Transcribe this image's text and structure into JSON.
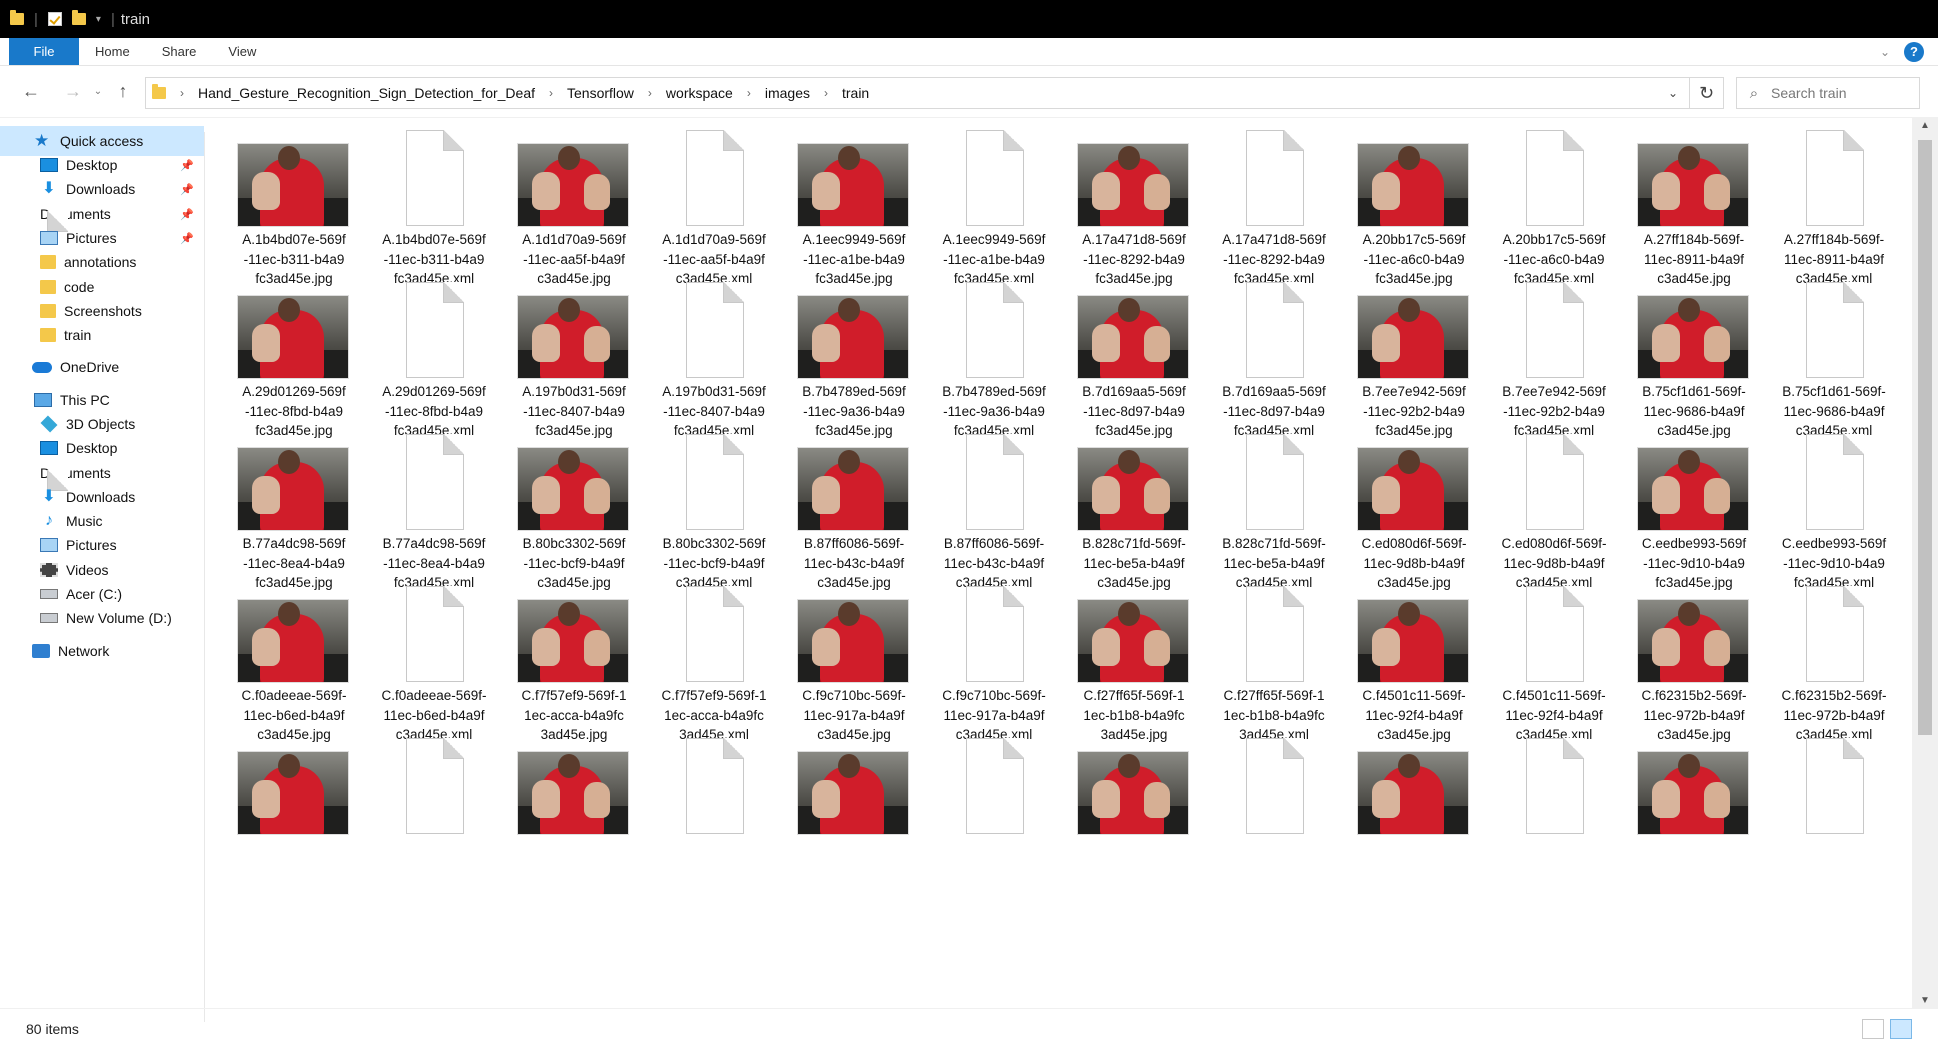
{
  "window": {
    "title": "train"
  },
  "ribbon": {
    "tabs": [
      "File",
      "Home",
      "Share",
      "View"
    ],
    "help": "?"
  },
  "address": {
    "crumbs": [
      "Hand_Gesture_Recognition_Sign_Detection_for_Deaf",
      "Tensorflow",
      "workspace",
      "images",
      "train"
    ]
  },
  "search": {
    "placeholder": "Search train"
  },
  "sidebar": {
    "items": [
      {
        "label": "Quick access",
        "icon": "star-icon"
      },
      {
        "label": "Desktop",
        "icon": "desktop-icon"
      },
      {
        "label": "Downloads",
        "icon": "download-icon"
      },
      {
        "label": "Documents",
        "icon": "documents-icon"
      },
      {
        "label": "Pictures",
        "icon": "pictures-icon"
      },
      {
        "label": "annotations",
        "icon": "folder-icon"
      },
      {
        "label": "code",
        "icon": "folder-icon"
      },
      {
        "label": "Screenshots",
        "icon": "folder-icon"
      },
      {
        "label": "train",
        "icon": "folder-icon"
      },
      {
        "label": "OneDrive",
        "icon": "cloud-icon"
      },
      {
        "label": "This PC",
        "icon": "computer-icon"
      },
      {
        "label": "3D Objects",
        "icon": "cube-icon"
      },
      {
        "label": "Desktop",
        "icon": "desktop-icon"
      },
      {
        "label": "Documents",
        "icon": "documents-icon"
      },
      {
        "label": "Downloads",
        "icon": "download-icon"
      },
      {
        "label": "Music",
        "icon": "music-icon"
      },
      {
        "label": "Pictures",
        "icon": "pictures-icon"
      },
      {
        "label": "Videos",
        "icon": "videos-icon"
      },
      {
        "label": "Acer (C:)",
        "icon": "drive-icon"
      },
      {
        "label": "New Volume (D:)",
        "icon": "drive-icon"
      },
      {
        "label": "Network",
        "icon": "network-icon"
      }
    ]
  },
  "files": [
    {
      "name": "A.1b4bd07e-569f\n-11ec-b311-b4a9\nfc3ad45e.jpg",
      "type": "image"
    },
    {
      "name": "A.1b4bd07e-569f\n-11ec-b311-b4a9\nfc3ad45e.xml",
      "type": "xml"
    },
    {
      "name": "A.1d1d70a9-569f\n-11ec-aa5f-b4a9f\nc3ad45e.jpg",
      "type": "image"
    },
    {
      "name": "A.1d1d70a9-569f\n-11ec-aa5f-b4a9f\nc3ad45e.xml",
      "type": "xml"
    },
    {
      "name": "A.1eec9949-569f\n-11ec-a1be-b4a9\nfc3ad45e.jpg",
      "type": "image"
    },
    {
      "name": "A.1eec9949-569f\n-11ec-a1be-b4a9\nfc3ad45e.xml",
      "type": "xml"
    },
    {
      "name": "A.17a471d8-569f\n-11ec-8292-b4a9\nfc3ad45e.jpg",
      "type": "image"
    },
    {
      "name": "A.17a471d8-569f\n-11ec-8292-b4a9\nfc3ad45e.xml",
      "type": "xml"
    },
    {
      "name": "A.20bb17c5-569f\n-11ec-a6c0-b4a9\nfc3ad45e.jpg",
      "type": "image"
    },
    {
      "name": "A.20bb17c5-569f\n-11ec-a6c0-b4a9\nfc3ad45e.xml",
      "type": "xml"
    },
    {
      "name": "A.27ff184b-569f-\n11ec-8911-b4a9f\nc3ad45e.jpg",
      "type": "image"
    },
    {
      "name": "A.27ff184b-569f-\n11ec-8911-b4a9f\nc3ad45e.xml",
      "type": "xml"
    },
    {
      "name": "A.29d01269-569f\n-11ec-8fbd-b4a9\nfc3ad45e.jpg",
      "type": "image"
    },
    {
      "name": "A.29d01269-569f\n-11ec-8fbd-b4a9\nfc3ad45e.xml",
      "type": "xml"
    },
    {
      "name": "A.197b0d31-569f\n-11ec-8407-b4a9\nfc3ad45e.jpg",
      "type": "image"
    },
    {
      "name": "A.197b0d31-569f\n-11ec-8407-b4a9\nfc3ad45e.xml",
      "type": "xml"
    },
    {
      "name": "B.7b4789ed-569f\n-11ec-9a36-b4a9\nfc3ad45e.jpg",
      "type": "image"
    },
    {
      "name": "B.7b4789ed-569f\n-11ec-9a36-b4a9\nfc3ad45e.xml",
      "type": "xml"
    },
    {
      "name": "B.7d169aa5-569f\n-11ec-8d97-b4a9\nfc3ad45e.jpg",
      "type": "image"
    },
    {
      "name": "B.7d169aa5-569f\n-11ec-8d97-b4a9\nfc3ad45e.xml",
      "type": "xml"
    },
    {
      "name": "B.7ee7e942-569f\n-11ec-92b2-b4a9\nfc3ad45e.jpg",
      "type": "image"
    },
    {
      "name": "B.7ee7e942-569f\n-11ec-92b2-b4a9\nfc3ad45e.xml",
      "type": "xml"
    },
    {
      "name": "B.75cf1d61-569f-\n11ec-9686-b4a9f\nc3ad45e.jpg",
      "type": "image"
    },
    {
      "name": "B.75cf1d61-569f-\n11ec-9686-b4a9f\nc3ad45e.xml",
      "type": "xml"
    },
    {
      "name": "B.77a4dc98-569f\n-11ec-8ea4-b4a9\nfc3ad45e.jpg",
      "type": "image"
    },
    {
      "name": "B.77a4dc98-569f\n-11ec-8ea4-b4a9\nfc3ad45e.xml",
      "type": "xml"
    },
    {
      "name": "B.80bc3302-569f\n-11ec-bcf9-b4a9f\nc3ad45e.jpg",
      "type": "image"
    },
    {
      "name": "B.80bc3302-569f\n-11ec-bcf9-b4a9f\nc3ad45e.xml",
      "type": "xml"
    },
    {
      "name": "B.87ff6086-569f-\n11ec-b43c-b4a9f\nc3ad45e.jpg",
      "type": "image"
    },
    {
      "name": "B.87ff6086-569f-\n11ec-b43c-b4a9f\nc3ad45e.xml",
      "type": "xml"
    },
    {
      "name": "B.828c71fd-569f-\n11ec-be5a-b4a9f\nc3ad45e.jpg",
      "type": "image"
    },
    {
      "name": "B.828c71fd-569f-\n11ec-be5a-b4a9f\nc3ad45e.xml",
      "type": "xml"
    },
    {
      "name": "C.ed080d6f-569f-\n11ec-9d8b-b4a9f\nc3ad45e.jpg",
      "type": "image"
    },
    {
      "name": "C.ed080d6f-569f-\n11ec-9d8b-b4a9f\nc3ad45e.xml",
      "type": "xml"
    },
    {
      "name": "C.eedbe993-569f\n-11ec-9d10-b4a9\nfc3ad45e.jpg",
      "type": "image"
    },
    {
      "name": "C.eedbe993-569f\n-11ec-9d10-b4a9\nfc3ad45e.xml",
      "type": "xml"
    },
    {
      "name": "C.f0adeeae-569f-\n11ec-b6ed-b4a9f\nc3ad45e.jpg",
      "type": "image"
    },
    {
      "name": "C.f0adeeae-569f-\n11ec-b6ed-b4a9f\nc3ad45e.xml",
      "type": "xml"
    },
    {
      "name": "C.f7f57ef9-569f-1\n1ec-acca-b4a9fc\n3ad45e.jpg",
      "type": "image"
    },
    {
      "name": "C.f7f57ef9-569f-1\n1ec-acca-b4a9fc\n3ad45e.xml",
      "type": "xml"
    },
    {
      "name": "C.f9c710bc-569f-\n11ec-917a-b4a9f\nc3ad45e.jpg",
      "type": "image"
    },
    {
      "name": "C.f9c710bc-569f-\n11ec-917a-b4a9f\nc3ad45e.xml",
      "type": "xml"
    },
    {
      "name": "C.f27ff65f-569f-1\n1ec-b1b8-b4a9fc\n3ad45e.jpg",
      "type": "image"
    },
    {
      "name": "C.f27ff65f-569f-1\n1ec-b1b8-b4a9fc\n3ad45e.xml",
      "type": "xml"
    },
    {
      "name": "C.f4501c11-569f-\n11ec-92f4-b4a9f\nc3ad45e.jpg",
      "type": "image"
    },
    {
      "name": "C.f4501c11-569f-\n11ec-92f4-b4a9f\nc3ad45e.xml",
      "type": "xml"
    },
    {
      "name": "C.f62315b2-569f-\n11ec-972b-b4a9f\nc3ad45e.jpg",
      "type": "image"
    },
    {
      "name": "C.f62315b2-569f-\n11ec-972b-b4a9f\nc3ad45e.xml",
      "type": "xml"
    },
    {
      "name": "",
      "type": "image"
    },
    {
      "name": "",
      "type": "xml"
    },
    {
      "name": "",
      "type": "image"
    },
    {
      "name": "",
      "type": "xml"
    },
    {
      "name": "",
      "type": "image"
    },
    {
      "name": "",
      "type": "xml"
    },
    {
      "name": "",
      "type": "image"
    },
    {
      "name": "",
      "type": "xml"
    },
    {
      "name": "",
      "type": "image"
    },
    {
      "name": "",
      "type": "xml"
    },
    {
      "name": "",
      "type": "image"
    },
    {
      "name": "",
      "type": "xml"
    }
  ],
  "status": {
    "count": "80 items"
  }
}
